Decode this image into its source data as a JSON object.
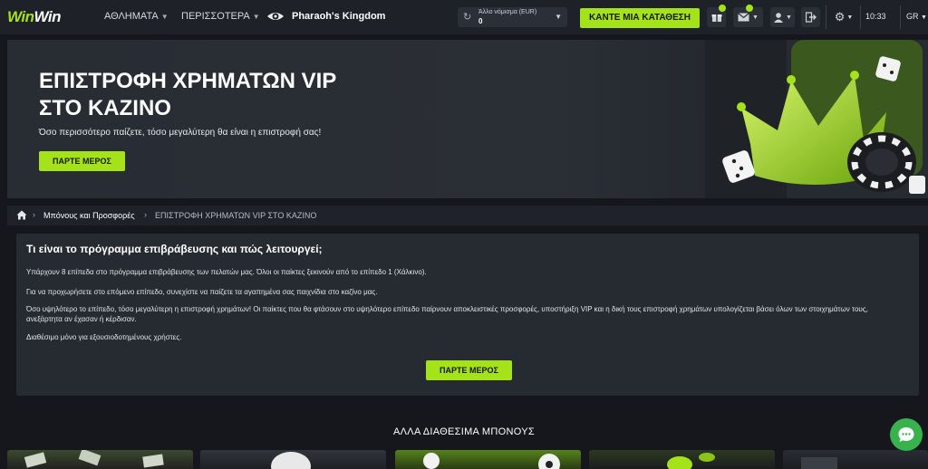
{
  "header": {
    "logo_part1": "Win",
    "logo_part2": "Win",
    "nav": {
      "sports": "ΑΘΛΗΜΑΤΑ",
      "more": "ΠΕΡΙΣΣΟΤΕΡΑ",
      "game": "Pharaoh's Kingdom"
    },
    "currency": {
      "label": "Άλλο νόμισμα  (EUR)",
      "value": "0"
    },
    "deposit_label": "ΚΑΝΤΕ ΜΙΑ ΚΑΤΑΘΕΣΗ",
    "gift_badge": "",
    "mail_badge": "",
    "time": "10:33",
    "lang": "GR",
    "accent_color": "#a4e21a"
  },
  "banner": {
    "title": "ΕΠΙΣΤΡΟΦΗ ΧΡΗΜΑΤΩΝ VIP ΣΤΟ ΚΑΖΙΝΟ",
    "subtitle": "Όσο περισσότερο παίζετε, τόσο μεγαλύτερη θα είναι η επιστροφή σας!",
    "button": "ΠΑΡΤΕ ΜΕΡΟΣ"
  },
  "breadcrumb": {
    "link": "Μπόνους και Προσφορές",
    "current": "ΕΠΙΣΤΡΟΦΗ ΧΡΗΜΑΤΩΝ VIP ΣΤΟ ΚΑΖΙΝΟ"
  },
  "info": {
    "heading": "Τι είναι το πρόγραμμα επιβράβευσης και πώς λειτουργεί;",
    "p1": "Υπάρχουν 8 επίπεδα στο πρόγραμμα επιβράβευσης των πελατών μας. Όλοι οι παίκτες ξεκινούν από το επίπεδο 1 (Χάλκινο).",
    "p2": "Για να προχωρήσετε στο επόμενο επίπεδο, συνεχίστε να παίζετε τα αγαπημένα σας παιχνίδια στο καζίνο μας.",
    "p3": "Όσο υψηλότερο το επίπεδο, τόσο μεγαλύτερη η επιστροφή χρημάτων! Οι παίκτες που θα φτάσουν στο υψηλότερο επίπεδο παίρνουν αποκλειστικές προσφορές, υποστήριξη VIP και η δική τους επιστροφή χρημάτων υπολογίζεται βάσει όλων των στοιχημάτων τους, ανεξάρτητα αν έχασαν ή κέρδισαν.",
    "p4": "Διαθέσιμο μόνο για εξουσιοδοτημένους χρήστες.",
    "button": "ΠΑΡΤΕ ΜΕΡΟΣ"
  },
  "other": {
    "title": "ΑΛΛΑ ΔΙΑΘΕΣΙΜΑ ΜΠΟΝΟΥΣ"
  }
}
